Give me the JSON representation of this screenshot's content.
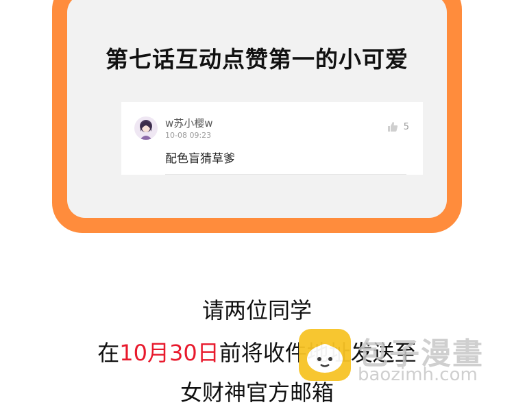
{
  "card": {
    "title": "第七话互动点赞第一的小可爱",
    "comment": {
      "user_name": "w苏小樱w",
      "time": "10-08 09:23",
      "text": "配色盲猜草爹",
      "like_count": "5"
    }
  },
  "message": {
    "line1": "请两位同学",
    "line2_prefix": "在",
    "line2_highlight": "10月30日",
    "line2_suffix": "前将收件地址发送至",
    "line3": "女财神官方邮箱"
  },
  "watermark": {
    "title": "包子漫畫",
    "url": "baozimh.com"
  },
  "colors": {
    "frame": "#ff8c3c",
    "highlight": "#e8192c",
    "watermark_logo": "#f7c325"
  }
}
